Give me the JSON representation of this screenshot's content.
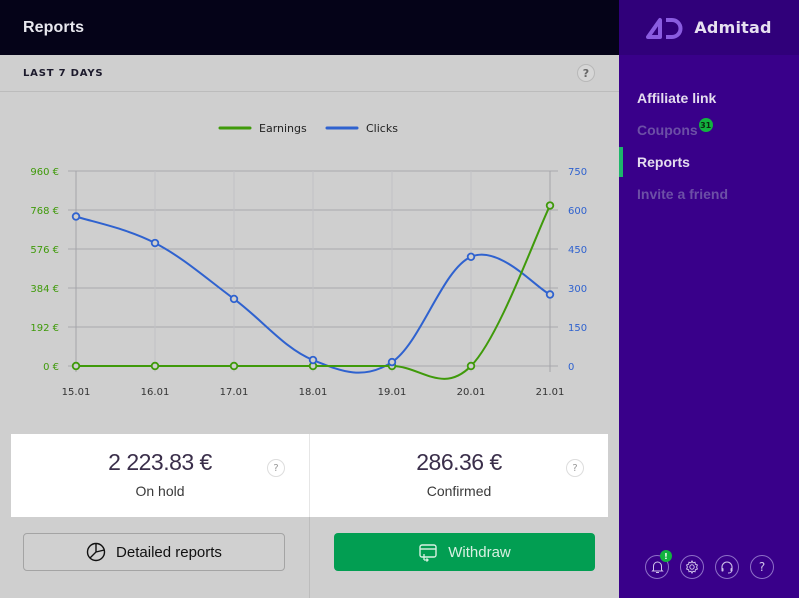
{
  "header": {
    "title": "Reports"
  },
  "period": {
    "label": "LAST 7 DAYS",
    "help_icon": "question-icon"
  },
  "colors": {
    "earnings": "#3f9a0a",
    "clicks": "#2f62cf",
    "accent_green": "#029e52",
    "sidebar_bg": "#39008a",
    "topbar_bg": "#050318"
  },
  "chart_data": {
    "type": "line",
    "title": "",
    "legend": [
      "Earnings",
      "Clicks"
    ],
    "legend_position": "top-center",
    "categories": [
      "15.01",
      "16.01",
      "17.01",
      "18.01",
      "19.01",
      "20.01",
      "21.01"
    ],
    "series": [
      {
        "name": "Earnings",
        "axis": "left",
        "values": [
          0,
          0,
          0,
          0,
          0,
          0,
          790
        ]
      },
      {
        "name": "Clicks",
        "axis": "right",
        "values": [
          575,
          473,
          258,
          23,
          15,
          420,
          275
        ]
      }
    ],
    "y_left": {
      "ticks": [
        "0 €",
        "192 €",
        "384 €",
        "576 €",
        "768 €",
        "960 €"
      ],
      "range": [
        0,
        960
      ]
    },
    "y_right": {
      "ticks": [
        "0",
        "150",
        "300",
        "450",
        "600",
        "750"
      ],
      "range": [
        0,
        750
      ]
    },
    "grid": true,
    "xlabel": "",
    "ylabel": ""
  },
  "summary": {
    "on_hold": {
      "amount": "2 223.83 €",
      "label": "On hold"
    },
    "confirmed": {
      "amount": "286.36 €",
      "label": "Confirmed"
    }
  },
  "actions": {
    "detailed_reports": "Detailed reports",
    "withdraw": "Withdraw"
  },
  "sidebar": {
    "brand": "Admitad",
    "items": [
      {
        "label": "Affiliate link",
        "state": "normal"
      },
      {
        "label": "Coupons",
        "state": "dim",
        "badge": "31"
      },
      {
        "label": "Reports",
        "state": "active"
      },
      {
        "label": "Invite a friend",
        "state": "dim"
      }
    ],
    "footer_icons": [
      "bell-icon",
      "gear-icon",
      "headset-icon",
      "question-icon"
    ],
    "notification_badge": "!"
  },
  "help_glyph": "?"
}
